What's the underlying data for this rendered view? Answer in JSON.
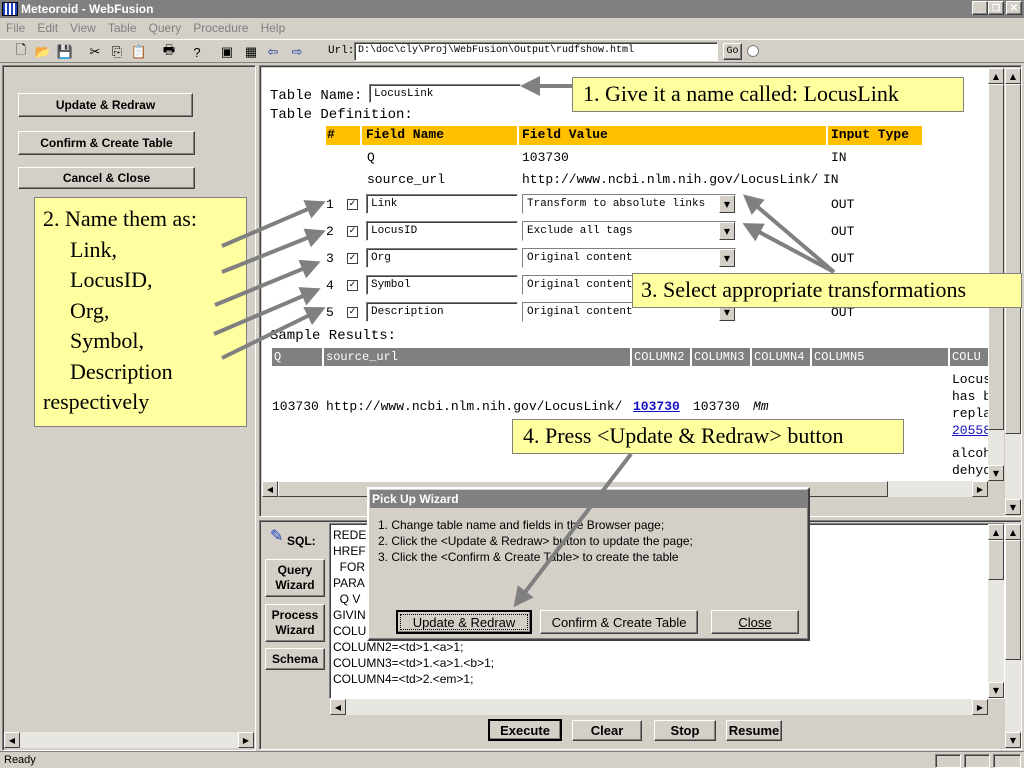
{
  "window": {
    "title": "Meteoroid - WebFusion"
  },
  "menu": [
    "File",
    "Edit",
    "View",
    "Table",
    "Query",
    "Procedure",
    "Help"
  ],
  "toolbar": {
    "url_label": "Url:",
    "url_value": "D:\\doc\\cly\\Proj\\WebFusion\\Output\\rudfshow.html",
    "go_label": "Go"
  },
  "left_panel": {
    "update_label": "Update & Redraw",
    "confirm_label": "Confirm & Create Table",
    "cancel_label": "Cancel & Close"
  },
  "callouts": {
    "c1": "1. Give it a name called: LocusLink",
    "c2": [
      "2. Name them as:",
      "Link,",
      "LocusID,",
      "Org,",
      "Symbol,",
      "Description",
      "respectively"
    ],
    "c3": "3. Select appropriate transformations",
    "c4": "4. Press <Update & Redraw> button"
  },
  "browser": {
    "table_name_label": "Table Name:",
    "table_name_value": "LocusLink",
    "table_def_label": "Table Definition:",
    "headers": [
      "#",
      "Field Name",
      "Field Value",
      "Input Type"
    ],
    "static_rows": [
      {
        "name": "Q",
        "value": "103730",
        "type": "IN"
      },
      {
        "name": "source_url",
        "value": "http://www.ncbi.nlm.nih.gov/LocusLink/",
        "type": "IN"
      }
    ],
    "rows": [
      {
        "num": "1",
        "checked": "✓",
        "name": "Link",
        "value": "Transform to absolute links",
        "type": "OUT"
      },
      {
        "num": "2",
        "checked": "✓",
        "name": "LocusID",
        "value": "Exclude all tags",
        "type": "OUT"
      },
      {
        "num": "3",
        "checked": "✓",
        "name": "Org",
        "value": "Original content",
        "type": "OUT"
      },
      {
        "num": "4",
        "checked": "✓",
        "name": "Symbol",
        "value": "Original content",
        "type": "OUT"
      },
      {
        "num": "5",
        "checked": "✓",
        "name": "Description",
        "value": "Original content",
        "type": "OUT"
      }
    ],
    "sample_label": "Sample Results:",
    "sample_headers": [
      "Q",
      "source_url",
      "COLUMN2",
      "COLUMN3",
      "COLUMN4",
      "COLUMN5",
      "COLU"
    ],
    "sample_row": {
      "q": "103730",
      "url": "http://www.ncbi.nlm.nih.gov/LocusLink/",
      "link": "103730",
      "id": "103730",
      "org": "Mm"
    },
    "sample_desc": [
      "Locus",
      "has b",
      "repla",
      "20558",
      "alcoh",
      "dehyd"
    ]
  },
  "sql_panel": {
    "sql_label": "SQL:",
    "query_wizard": "Query Wizard",
    "process_wizard": "Process Wizard",
    "schema": "Schema",
    "lines": [
      "REDE",
      "HREF",
      "  FOR",
      "PARA",
      "  Q V",
      "GIVIN",
      "COLU",
      "COLUMN2=<td>1.<a>1;",
      "COLUMN3=<td>1.<a>1.<b>1;",
      "COLUMN4=<td>2.<em>1;"
    ],
    "execute": "Execute",
    "clear": "Clear",
    "stop": "Stop",
    "resume": "Resume"
  },
  "dialog": {
    "title": "Pick Up Wizard",
    "lines": [
      "1. Change table name and fields in the Browser page;",
      "2. Click the <Update & Redraw> button to update the page;",
      "3. Click the <Confirm & Create Table> to create the table"
    ],
    "update": "Update & Redraw",
    "confirm": "Confirm & Create Table",
    "close": "Close"
  },
  "status": {
    "text": "Ready"
  }
}
